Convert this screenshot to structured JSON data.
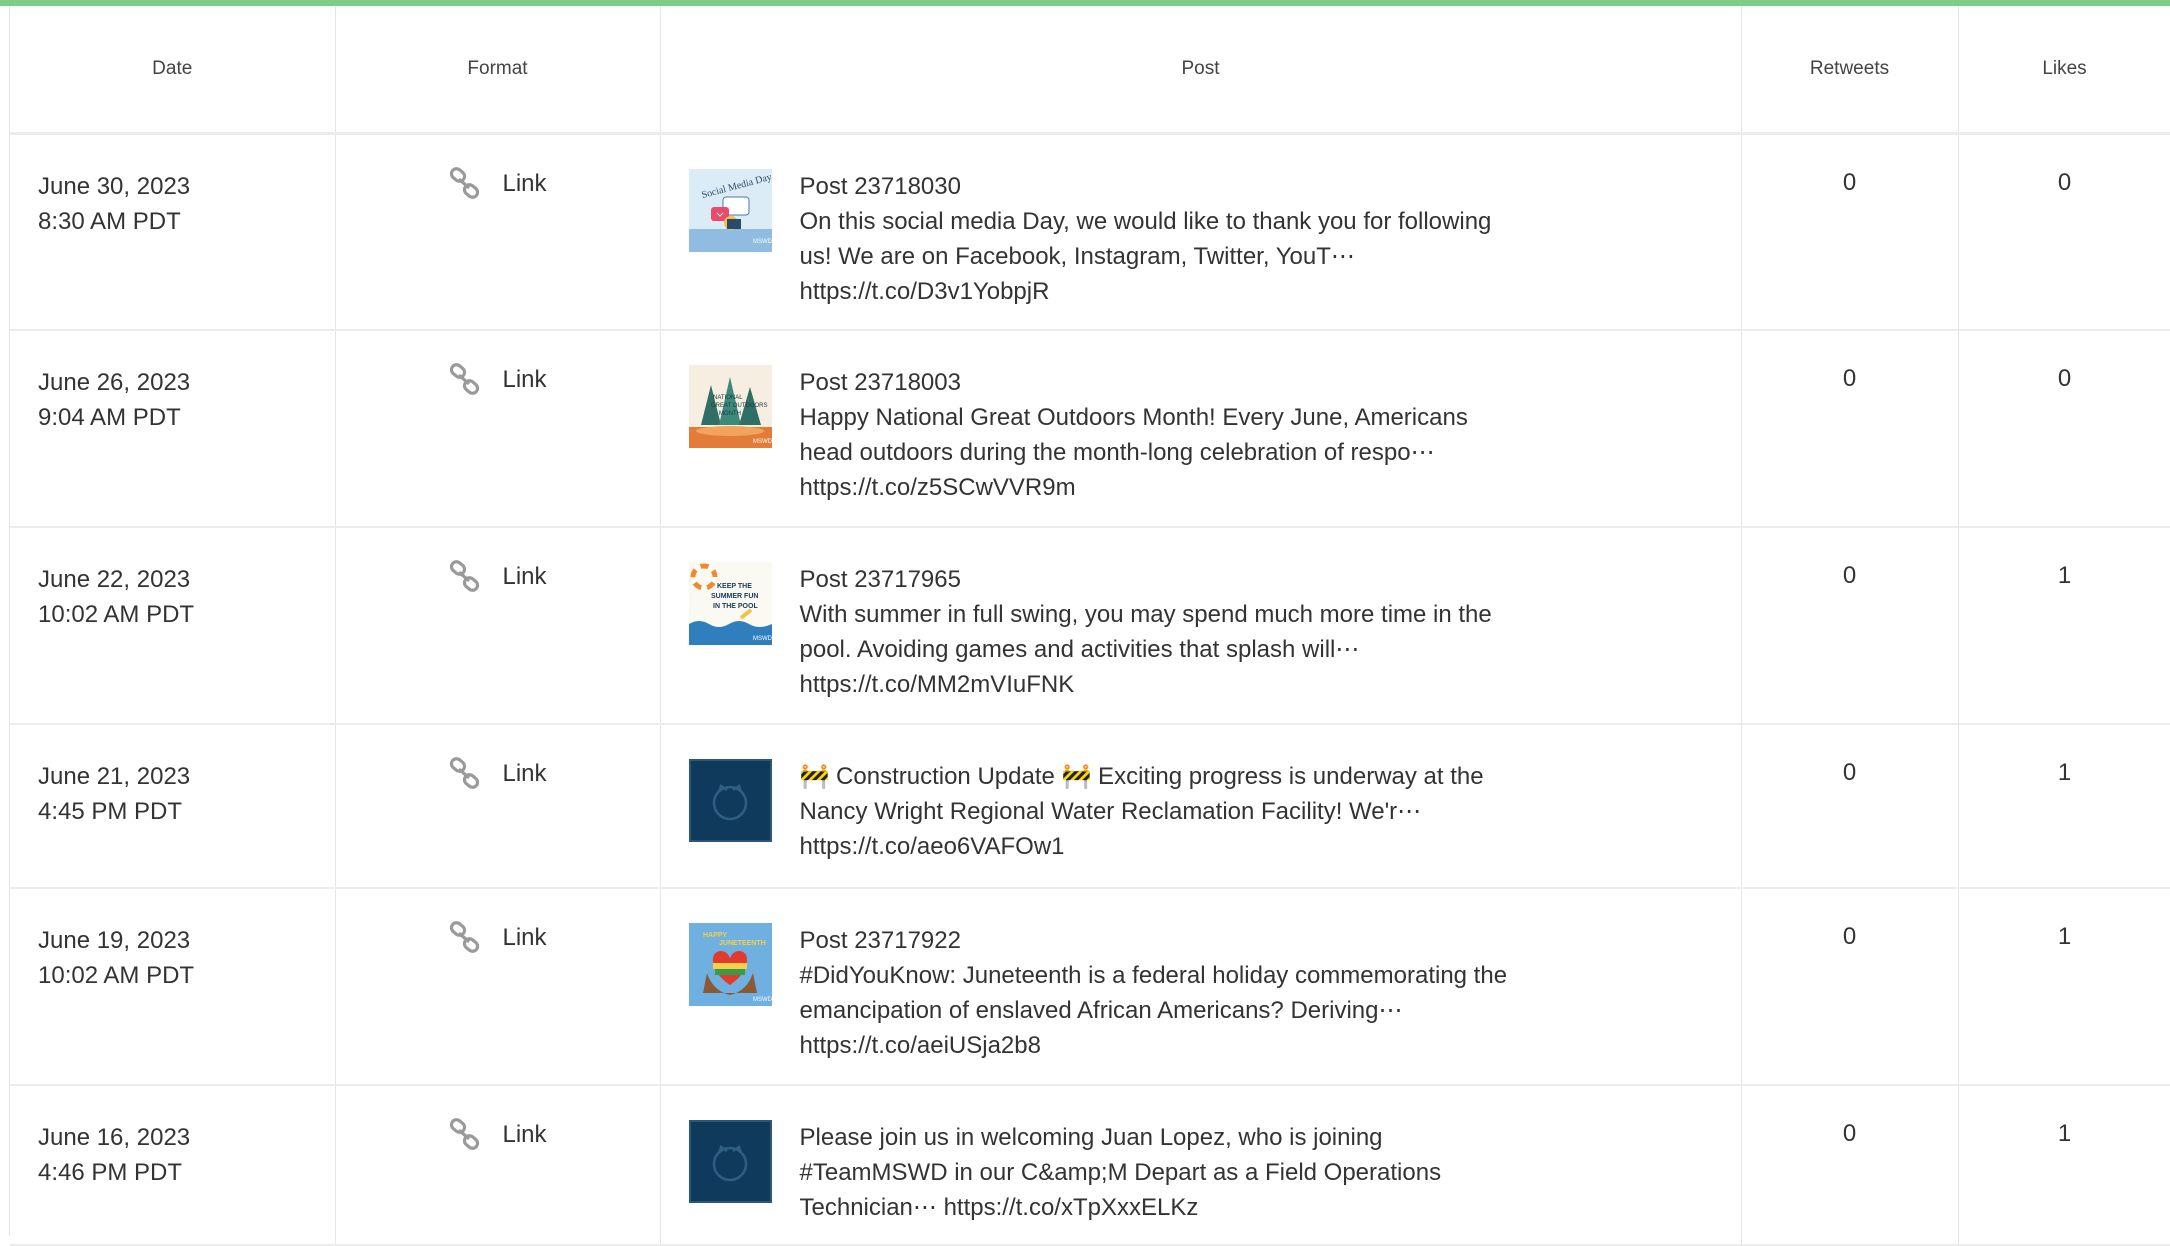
{
  "columns": {
    "date": "Date",
    "format": "Format",
    "post": "Post",
    "retweets": "Retweets",
    "likes": "Likes"
  },
  "rows": [
    {
      "date": "June 30, 2023",
      "time": "8:30 AM PDT",
      "format": "Link",
      "thumb": "social-media-day",
      "title": "Post 23718030",
      "text": "On this social media Day, we would like to thank you for following us! We are on Facebook, Instagram, Twitter, YouT⋯",
      "link": "https://t.co/D3v1YobpjR",
      "retweets": "0",
      "likes": "0"
    },
    {
      "date": "June 26, 2023",
      "time": "9:04 AM PDT",
      "format": "Link",
      "thumb": "great-outdoors-month",
      "title": "Post 23718003",
      "text": "Happy National Great Outdoors Month! Every June, Americans head outdoors during the month-long celebration of respo⋯",
      "link": "https://t.co/z5SCwVVR9m",
      "retweets": "0",
      "likes": "0"
    },
    {
      "date": "June 22, 2023",
      "time": "10:02 AM PDT",
      "format": "Link",
      "thumb": "summer-pool",
      "title": "Post 23717965",
      "text": "With summer in full swing, you may spend much more time in the pool. Avoiding games and activities that splash will⋯",
      "link": "https://t.co/MM2mVIuFNK",
      "retweets": "0",
      "likes": "1"
    },
    {
      "date": "June 21, 2023",
      "time": "4:45 PM PDT",
      "format": "Link",
      "thumb": "placeholder",
      "title": "",
      "text": "🚧 Construction Update 🚧 Exciting progress is underway at the Nancy Wright Regional Water Reclamation Facility! We'r⋯",
      "link": "https://t.co/aeo6VAFOw1",
      "retweets": "0",
      "likes": "1"
    },
    {
      "date": "June 19, 2023",
      "time": "10:02 AM PDT",
      "format": "Link",
      "thumb": "juneteenth",
      "title": "Post 23717922",
      "text": "#DidYouKnow: Juneteenth is a federal holiday commemorating the emancipation of enslaved African Americans? Deriving⋯",
      "link": "https://t.co/aeiUSja2b8",
      "retweets": "0",
      "likes": "1"
    },
    {
      "date": "June 16, 2023",
      "time": "4:46 PM PDT",
      "format": "Link",
      "thumb": "placeholder",
      "title": "",
      "text": "Please join us in welcoming Juan Lopez, who is joining #TeamMSWD in our C&amp;M Depart as a Field Operations Technician⋯ https://t.co/xTpXxxELKz",
      "link": "",
      "retweets": "0",
      "likes": "1"
    }
  ],
  "colors": {
    "accent_bar": "#7dcc8a",
    "placeholder_bg": "#0f3a5c",
    "border": "#e6e6e6"
  }
}
